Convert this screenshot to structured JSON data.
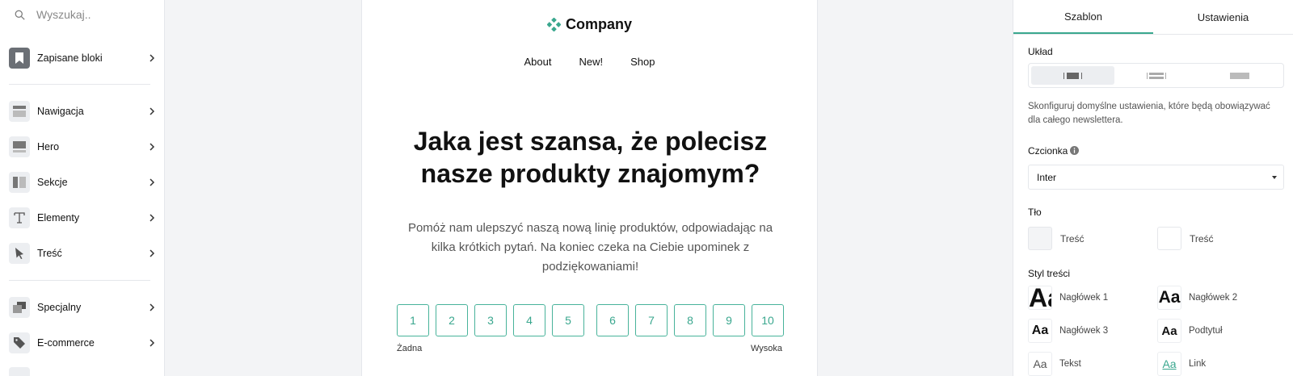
{
  "search": {
    "placeholder": "Wyszukaj.."
  },
  "sidebar": {
    "items": [
      {
        "label": "Zapisane bloki",
        "icon": "bookmark-icon"
      },
      {
        "label": "Nawigacja",
        "icon": "navigation-block-icon"
      },
      {
        "label": "Hero",
        "icon": "hero-block-icon"
      },
      {
        "label": "Sekcje",
        "icon": "columns-icon"
      },
      {
        "label": "Elementy",
        "icon": "text-t-icon"
      },
      {
        "label": "Treść",
        "icon": "cursor-icon"
      },
      {
        "label": "Specjalny",
        "icon": "layers-icon"
      },
      {
        "label": "E-commerce",
        "icon": "tag-icon"
      }
    ]
  },
  "canvas": {
    "brand": "Company",
    "nav": [
      "About",
      "New!",
      "Shop"
    ],
    "headline": "Jaka jest szansa, że polecisz nasze produkty znajomym?",
    "subtext": "Pomóż nam ulepszyć naszą nową linię produktów, odpowiadając na kilka krótkich pytań. Na koniec czeka na Ciebie upominek z podziękowaniami!",
    "scale": [
      "1",
      "2",
      "3",
      "4",
      "5",
      "6",
      "7",
      "8",
      "9",
      "10"
    ],
    "scale_low": "Żadna",
    "scale_high": "Wysoka"
  },
  "panel": {
    "tabs": [
      "Szablon",
      "Ustawienia"
    ],
    "layout_label": "Układ",
    "help": "Skonfiguruj domyślne ustawienia, które będą obowiązywać dla całego newslettera.",
    "font_label": "Czcionka",
    "font_value": "Inter",
    "bg_label": "Tło",
    "bg_items": [
      {
        "label": "Treść",
        "color": "#f3f4f6"
      },
      {
        "label": "Treść",
        "color": "#ffffff"
      }
    ],
    "style_label": "Styl treści",
    "styles": [
      {
        "sample": "Aa",
        "label": "Nagłówek 1"
      },
      {
        "sample": "Aa",
        "label": "Nagłówek 2"
      },
      {
        "sample": "Aa",
        "label": "Nagłówek 3"
      },
      {
        "sample": "Aa",
        "label": "Podtytuł"
      },
      {
        "sample": "Aa",
        "label": "Tekst"
      },
      {
        "sample": "Aa",
        "label": "Link"
      }
    ]
  },
  "colors": {
    "accent": "#3aa78e",
    "canvas_bg": "#f3f4f6"
  }
}
